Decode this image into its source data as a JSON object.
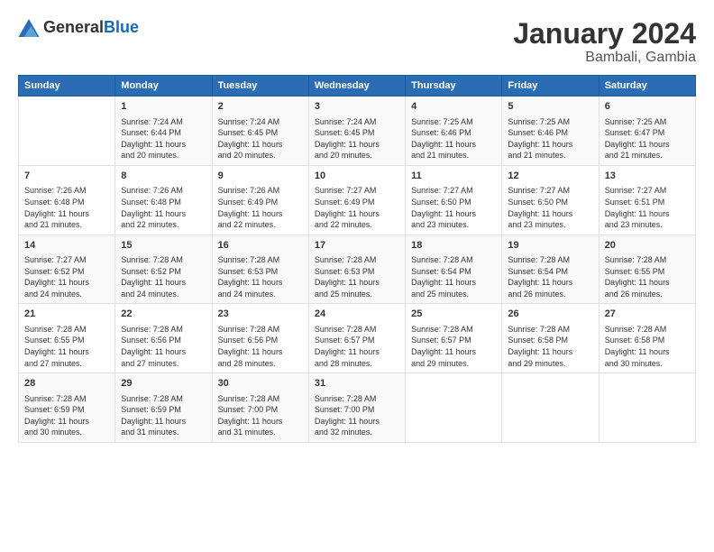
{
  "logo": {
    "general": "General",
    "blue": "Blue"
  },
  "title": "January 2024",
  "subtitle": "Bambali, Gambia",
  "days_header": [
    "Sunday",
    "Monday",
    "Tuesday",
    "Wednesday",
    "Thursday",
    "Friday",
    "Saturday"
  ],
  "weeks": [
    [
      {
        "num": "",
        "info": ""
      },
      {
        "num": "1",
        "info": "Sunrise: 7:24 AM\nSunset: 6:44 PM\nDaylight: 11 hours\nand 20 minutes."
      },
      {
        "num": "2",
        "info": "Sunrise: 7:24 AM\nSunset: 6:45 PM\nDaylight: 11 hours\nand 20 minutes."
      },
      {
        "num": "3",
        "info": "Sunrise: 7:24 AM\nSunset: 6:45 PM\nDaylight: 11 hours\nand 20 minutes."
      },
      {
        "num": "4",
        "info": "Sunrise: 7:25 AM\nSunset: 6:46 PM\nDaylight: 11 hours\nand 21 minutes."
      },
      {
        "num": "5",
        "info": "Sunrise: 7:25 AM\nSunset: 6:46 PM\nDaylight: 11 hours\nand 21 minutes."
      },
      {
        "num": "6",
        "info": "Sunrise: 7:25 AM\nSunset: 6:47 PM\nDaylight: 11 hours\nand 21 minutes."
      }
    ],
    [
      {
        "num": "7",
        "info": "Sunrise: 7:26 AM\nSunset: 6:48 PM\nDaylight: 11 hours\nand 21 minutes."
      },
      {
        "num": "8",
        "info": "Sunrise: 7:26 AM\nSunset: 6:48 PM\nDaylight: 11 hours\nand 22 minutes."
      },
      {
        "num": "9",
        "info": "Sunrise: 7:26 AM\nSunset: 6:49 PM\nDaylight: 11 hours\nand 22 minutes."
      },
      {
        "num": "10",
        "info": "Sunrise: 7:27 AM\nSunset: 6:49 PM\nDaylight: 11 hours\nand 22 minutes."
      },
      {
        "num": "11",
        "info": "Sunrise: 7:27 AM\nSunset: 6:50 PM\nDaylight: 11 hours\nand 23 minutes."
      },
      {
        "num": "12",
        "info": "Sunrise: 7:27 AM\nSunset: 6:50 PM\nDaylight: 11 hours\nand 23 minutes."
      },
      {
        "num": "13",
        "info": "Sunrise: 7:27 AM\nSunset: 6:51 PM\nDaylight: 11 hours\nand 23 minutes."
      }
    ],
    [
      {
        "num": "14",
        "info": "Sunrise: 7:27 AM\nSunset: 6:52 PM\nDaylight: 11 hours\nand 24 minutes."
      },
      {
        "num": "15",
        "info": "Sunrise: 7:28 AM\nSunset: 6:52 PM\nDaylight: 11 hours\nand 24 minutes."
      },
      {
        "num": "16",
        "info": "Sunrise: 7:28 AM\nSunset: 6:53 PM\nDaylight: 11 hours\nand 24 minutes."
      },
      {
        "num": "17",
        "info": "Sunrise: 7:28 AM\nSunset: 6:53 PM\nDaylight: 11 hours\nand 25 minutes."
      },
      {
        "num": "18",
        "info": "Sunrise: 7:28 AM\nSunset: 6:54 PM\nDaylight: 11 hours\nand 25 minutes."
      },
      {
        "num": "19",
        "info": "Sunrise: 7:28 AM\nSunset: 6:54 PM\nDaylight: 11 hours\nand 26 minutes."
      },
      {
        "num": "20",
        "info": "Sunrise: 7:28 AM\nSunset: 6:55 PM\nDaylight: 11 hours\nand 26 minutes."
      }
    ],
    [
      {
        "num": "21",
        "info": "Sunrise: 7:28 AM\nSunset: 6:55 PM\nDaylight: 11 hours\nand 27 minutes."
      },
      {
        "num": "22",
        "info": "Sunrise: 7:28 AM\nSunset: 6:56 PM\nDaylight: 11 hours\nand 27 minutes."
      },
      {
        "num": "23",
        "info": "Sunrise: 7:28 AM\nSunset: 6:56 PM\nDaylight: 11 hours\nand 28 minutes."
      },
      {
        "num": "24",
        "info": "Sunrise: 7:28 AM\nSunset: 6:57 PM\nDaylight: 11 hours\nand 28 minutes."
      },
      {
        "num": "25",
        "info": "Sunrise: 7:28 AM\nSunset: 6:57 PM\nDaylight: 11 hours\nand 29 minutes."
      },
      {
        "num": "26",
        "info": "Sunrise: 7:28 AM\nSunset: 6:58 PM\nDaylight: 11 hours\nand 29 minutes."
      },
      {
        "num": "27",
        "info": "Sunrise: 7:28 AM\nSunset: 6:58 PM\nDaylight: 11 hours\nand 30 minutes."
      }
    ],
    [
      {
        "num": "28",
        "info": "Sunrise: 7:28 AM\nSunset: 6:59 PM\nDaylight: 11 hours\nand 30 minutes."
      },
      {
        "num": "29",
        "info": "Sunrise: 7:28 AM\nSunset: 6:59 PM\nDaylight: 11 hours\nand 31 minutes."
      },
      {
        "num": "30",
        "info": "Sunrise: 7:28 AM\nSunset: 7:00 PM\nDaylight: 11 hours\nand 31 minutes."
      },
      {
        "num": "31",
        "info": "Sunrise: 7:28 AM\nSunset: 7:00 PM\nDaylight: 11 hours\nand 32 minutes."
      },
      {
        "num": "",
        "info": ""
      },
      {
        "num": "",
        "info": ""
      },
      {
        "num": "",
        "info": ""
      }
    ]
  ]
}
